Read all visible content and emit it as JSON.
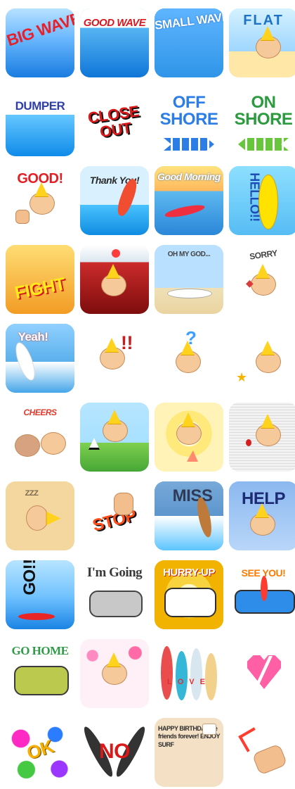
{
  "stickers": [
    {
      "label": "BIG WAVE",
      "color": "#e7212a",
      "bg": "#74b8ef"
    },
    {
      "label": "GOOD WAVE",
      "color": "#d7181f",
      "bg": "#4ba0e6"
    },
    {
      "label": "SMALL WAVE",
      "color": "#1c5fd0",
      "bg": "#5bb3ea"
    },
    {
      "label": "FLAT",
      "color": "#1e73c7",
      "bg": "#9fd6ff"
    },
    {
      "label": "DUMPER",
      "color": "#2f3fa8",
      "bg": "#d8e9ff"
    },
    {
      "label": "CLOSE OUT",
      "color": "#d91919",
      "bg": "#ffffff"
    },
    {
      "label": "OFF SHORE",
      "color": "#2c7de6",
      "bg": "#ffffff"
    },
    {
      "label": "ON SHORE",
      "color": "#2c9b3f",
      "bg": "#ffffff"
    },
    {
      "label": "GOOD!",
      "color": "#e31e24",
      "bg": "#ffffff"
    },
    {
      "label": "Thank You!",
      "color": "#2a2a2a",
      "bg": "#d8f0ff"
    },
    {
      "label": "Good Morning",
      "color": "#ffffff",
      "bg": "#4cb0e8"
    },
    {
      "label": "HELLO!!",
      "color": "#1d4db5",
      "bg": "#7fd3ff"
    },
    {
      "label": "FIGHT",
      "color": "#ffea1a",
      "bg": "#f6a21c"
    },
    {
      "label": "",
      "color": "#2b2b2b",
      "bg": "#dbe6ef"
    },
    {
      "label": "OH MY GOD...",
      "color": "#444444",
      "bg": "#cfe7ff"
    },
    {
      "label": "SORRY",
      "color": "#444444",
      "bg": "#ffffff"
    },
    {
      "label": "Yeah!",
      "color": "#ffffff",
      "bg": "#5ab0ec"
    },
    {
      "label": "!!",
      "color": "#c81d1d",
      "bg": "#ffffff"
    },
    {
      "label": "?",
      "color": "#3aa0ff",
      "bg": "#ffffff"
    },
    {
      "label": "",
      "color": "#d7a70b",
      "bg": "#ffffff"
    },
    {
      "label": "CHEERS",
      "color": "#e03a2d",
      "bg": "#ffffff"
    },
    {
      "label": "",
      "color": "#3a6fd8",
      "bg": "#a7e0ff"
    },
    {
      "label": "",
      "color": "#f0b42a",
      "bg": "#fff3b8"
    },
    {
      "label": "",
      "color": "#d51f1f",
      "bg": "#f2f2f2"
    },
    {
      "label": "",
      "color": "#d9a86c",
      "bg": "#f4d79e"
    },
    {
      "label": "STOP",
      "color": "#ff4d1a",
      "bg": "#ffffff"
    },
    {
      "label": "MISS",
      "color": "#2f3b56",
      "bg": "#5c96cd"
    },
    {
      "label": "HELP",
      "color": "#1d2b74",
      "bg": "#a5c7f2"
    },
    {
      "label": "GO!!",
      "color": "#111111",
      "bg": "#7bc6ff"
    },
    {
      "label": "I'm Going",
      "color": "#3a3a3a",
      "bg": "#ffffff"
    },
    {
      "label": "HURRY-UP",
      "color": "#ffffff",
      "bg": "#f3c11f"
    },
    {
      "label": "SEE YOU!",
      "color": "#ff7a00",
      "bg": "#ffffff"
    },
    {
      "label": "GO HOME",
      "color": "#2f9a47",
      "bg": "#ffffff"
    },
    {
      "label": "",
      "color": "#ff4fa3",
      "bg": "#fff0f7"
    },
    {
      "label": "LOVE",
      "color": "#e12f2f",
      "bg": "#ffffff"
    },
    {
      "label": "",
      "color": "#ff5fa4",
      "bg": "#ffffff"
    },
    {
      "label": "OK",
      "color": "#f7b000",
      "bg": "#ffffff"
    },
    {
      "label": "NO",
      "color": "#d91818",
      "bg": "#ffffff"
    },
    {
      "label": "HAPPY BIRTHDAY Be friends forever! ENJOY SURF",
      "color": "#2f2f2f",
      "bg": "#f4e1c5"
    },
    {
      "label": "",
      "color": "#333333",
      "bg": "#ffffff"
    }
  ]
}
